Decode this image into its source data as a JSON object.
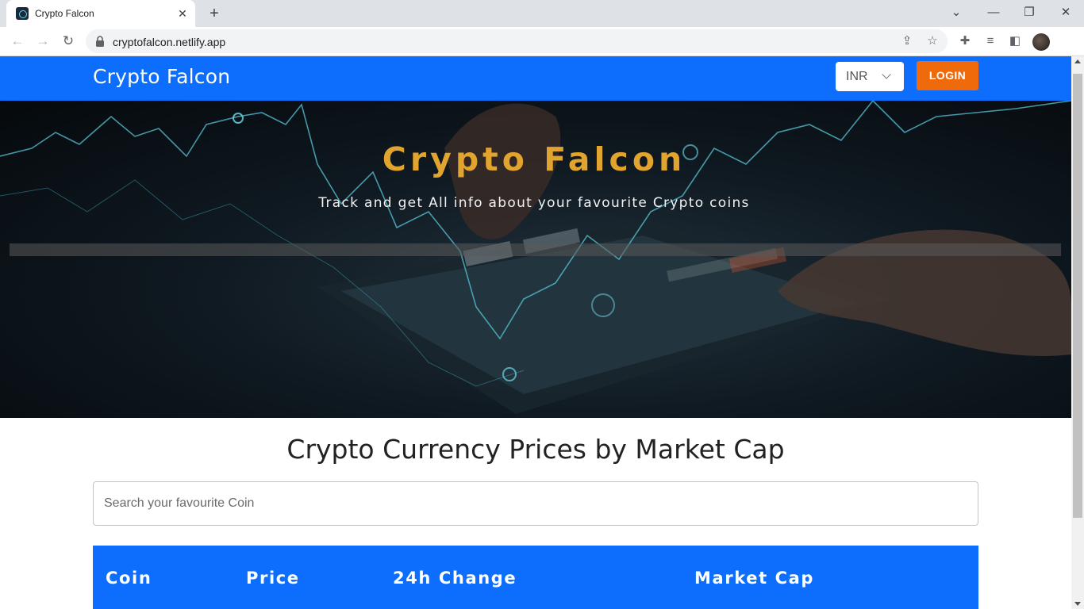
{
  "browser": {
    "tab_title": "Crypto Falcon",
    "url": "cryptofalcon.netlify.app"
  },
  "header": {
    "brand": "Crypto Falcon",
    "currency": "INR",
    "login_label": "LOGIN"
  },
  "hero": {
    "title": "Crypto Falcon",
    "subtitle": "Track and get All info about your favourite Crypto coins"
  },
  "main": {
    "heading": "Crypto Currency Prices by Market Cap",
    "search_placeholder": "Search your favourite Coin",
    "table_headers": [
      "Coin",
      "Price",
      "24h Change",
      "Market Cap"
    ]
  },
  "colors": {
    "appbar": "#0d6efd",
    "hero_title": "#e1a42e",
    "login_button": "#ee6a0a"
  },
  "icons": [
    "react-favicon",
    "close-icon",
    "plus-icon",
    "minimize-icon",
    "maximize-icon",
    "back-icon",
    "forward-icon",
    "reload-icon",
    "lock-icon",
    "share-icon",
    "star-icon",
    "extensions-icon",
    "media-icon",
    "sidepanel-icon",
    "chevron-down-icon"
  ]
}
